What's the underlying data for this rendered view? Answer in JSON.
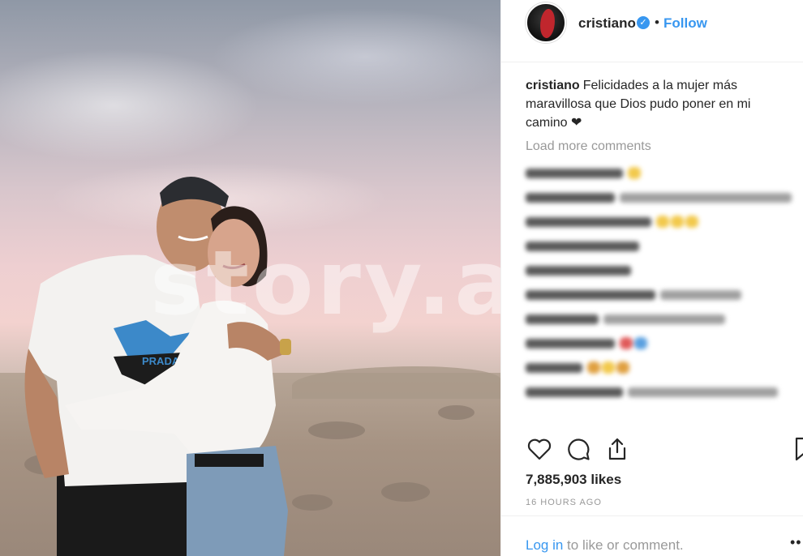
{
  "photo": {
    "watermark": "story.al"
  },
  "header": {
    "username": "cristiano",
    "verified_mark": "✓",
    "separator": "•",
    "follow_label": "Follow"
  },
  "caption": {
    "username": "cristiano",
    "text": "Felicidades a la mujer más maravillosa que Dios pudo poner en mi camino ❤"
  },
  "comments_section": {
    "load_more": "Load more comments",
    "blurred_comments": [
      {
        "user_w": 120,
        "text_w": 0,
        "emoji": [
          "#f2c94c"
        ]
      },
      {
        "user_w": 110,
        "text_w": 220,
        "emoji": []
      },
      {
        "user_w": 155,
        "text_w": 0,
        "emoji": [
          "#f2c94c",
          "#f2c94c",
          "#f2c94c"
        ]
      },
      {
        "user_w": 140,
        "text_w": 0,
        "emoji": []
      },
      {
        "user_w": 130,
        "text_w": 0,
        "emoji": []
      },
      {
        "user_w": 160,
        "text_w": 100,
        "emoji": []
      },
      {
        "user_w": 90,
        "text_w": 150,
        "emoji": []
      },
      {
        "user_w": 110,
        "text_w": 0,
        "emoji": [
          "#e05a5a",
          "#5aa0e0"
        ]
      },
      {
        "user_w": 70,
        "text_w": 0,
        "emoji": [
          "#e0a040",
          "#f2c94c",
          "#e0a040"
        ]
      },
      {
        "user_w": 120,
        "text_w": 185,
        "emoji": []
      }
    ]
  },
  "actions": {
    "like_icon": "heart-icon",
    "comment_icon": "speech-bubble-icon",
    "share_icon": "share-icon",
    "save_icon": "bookmark-icon"
  },
  "likes": "7,885,903 likes",
  "timestamp": "16 HOURS AGO",
  "footer": {
    "login_link": "Log in",
    "login_rest": " to like or comment.",
    "more_label": "••"
  },
  "colors": {
    "link_blue": "#3897f0",
    "text": "#262626",
    "muted": "#999999",
    "border": "#efefef"
  }
}
